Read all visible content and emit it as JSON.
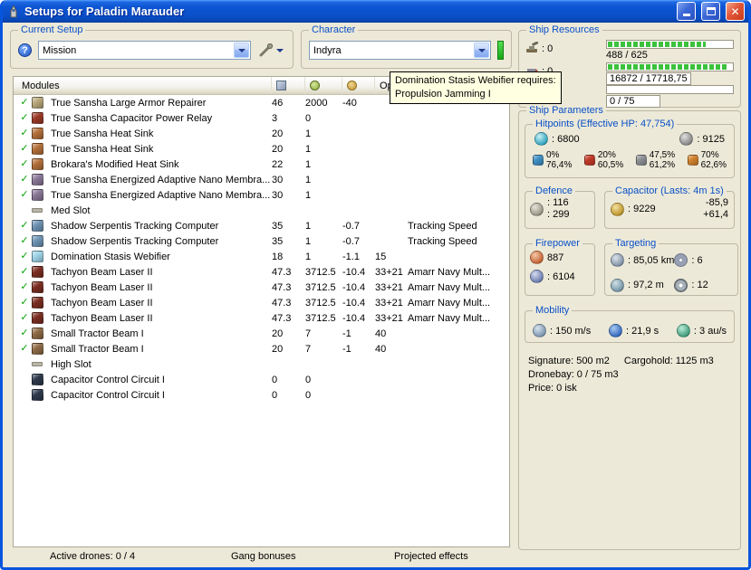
{
  "window": {
    "title": "Setups for Paladin Marauder"
  },
  "current_setup": {
    "label": "Current Setup",
    "value": "Mission"
  },
  "character": {
    "label": "Character",
    "value": "Indyra"
  },
  "ship_resources": {
    "label": "Ship Resources",
    "rows": [
      {
        "icon": "turret-hardpoint-icon",
        "count": ": 0",
        "bar_text": "488 / 625",
        "fill_pct": 78,
        "boxed": false
      },
      {
        "icon": "launcher-hardpoint-icon",
        "count": ": 0",
        "bar_text": "16872 / 17718,75",
        "fill_pct": 95,
        "boxed": true
      },
      {
        "icon": "drone-bay-icon",
        "count": ": 00",
        "bar_text": "0 / 75",
        "fill_pct": 0,
        "boxed": true
      }
    ]
  },
  "tooltip": {
    "line1": "Domination Stasis Webifier requires:",
    "line2": "Propulsion Jamming I"
  },
  "modules_panel": {
    "header_label": "Modules",
    "opti_label": "Opti...",
    "rows": [
      {
        "checked": true,
        "slot": false,
        "icon_color": "#b9a87c",
        "name": "True Sansha Large Armor Repairer",
        "cpu": "46",
        "pg": "2000",
        "cap": "-40",
        "opti": "",
        "charge": ""
      },
      {
        "checked": true,
        "slot": false,
        "icon_color": "#9c3a28",
        "name": "True Sansha Capacitor Power Relay",
        "cpu": "3",
        "pg": "0",
        "cap": "",
        "opti": "",
        "charge": ""
      },
      {
        "checked": true,
        "slot": false,
        "icon_color": "#b4703a",
        "name": "True Sansha Heat Sink",
        "cpu": "20",
        "pg": "1",
        "cap": "",
        "opti": "",
        "charge": ""
      },
      {
        "checked": true,
        "slot": false,
        "icon_color": "#b4703a",
        "name": "True Sansha Heat Sink",
        "cpu": "20",
        "pg": "1",
        "cap": "",
        "opti": "",
        "charge": ""
      },
      {
        "checked": true,
        "slot": false,
        "icon_color": "#b4703a",
        "name": "Brokara's Modified Heat Sink",
        "cpu": "22",
        "pg": "1",
        "cap": "",
        "opti": "",
        "charge": ""
      },
      {
        "checked": true,
        "slot": false,
        "icon_color": "#8a7898",
        "name": "True Sansha Energized Adaptive Nano Membra...",
        "cpu": "30",
        "pg": "1",
        "cap": "",
        "opti": "",
        "charge": ""
      },
      {
        "checked": true,
        "slot": false,
        "icon_color": "#8a7898",
        "name": "True Sansha Energized Adaptive Nano Membra...",
        "cpu": "30",
        "pg": "1",
        "cap": "",
        "opti": "",
        "charge": ""
      },
      {
        "checked": false,
        "slot": true,
        "icon_color": "#b0aca0",
        "name": "Med Slot",
        "cpu": "",
        "pg": "",
        "cap": "",
        "opti": "",
        "charge": ""
      },
      {
        "checked": true,
        "slot": false,
        "icon_color": "#6f94b5",
        "name": "Shadow Serpentis Tracking Computer",
        "cpu": "35",
        "pg": "1",
        "cap": "-0.7",
        "opti": "",
        "charge": "Tracking Speed"
      },
      {
        "checked": true,
        "slot": false,
        "icon_color": "#6f94b5",
        "name": "Shadow Serpentis Tracking Computer",
        "cpu": "35",
        "pg": "1",
        "cap": "-0.7",
        "opti": "",
        "charge": "Tracking Speed"
      },
      {
        "checked": true,
        "slot": false,
        "icon_color": "#9fd4e8",
        "name": "Domination Stasis Webifier",
        "cpu": "18",
        "pg": "1",
        "cap": "-1.1",
        "opti": "15",
        "charge": ""
      },
      {
        "checked": true,
        "slot": false,
        "icon_color": "#7c2e22",
        "name": "Tachyon Beam Laser II",
        "cpu": "47.3",
        "pg": "3712.5",
        "cap": "-10.4",
        "opti": "33+21",
        "charge": "Amarr Navy Mult..."
      },
      {
        "checked": true,
        "slot": false,
        "icon_color": "#7c2e22",
        "name": "Tachyon Beam Laser II",
        "cpu": "47.3",
        "pg": "3712.5",
        "cap": "-10.4",
        "opti": "33+21",
        "charge": "Amarr Navy Mult..."
      },
      {
        "checked": true,
        "slot": false,
        "icon_color": "#7c2e22",
        "name": "Tachyon Beam Laser II",
        "cpu": "47.3",
        "pg": "3712.5",
        "cap": "-10.4",
        "opti": "33+21",
        "charge": "Amarr Navy Mult..."
      },
      {
        "checked": true,
        "slot": false,
        "icon_color": "#7c2e22",
        "name": "Tachyon Beam Laser II",
        "cpu": "47.3",
        "pg": "3712.5",
        "cap": "-10.4",
        "opti": "33+21",
        "charge": "Amarr Navy Mult..."
      },
      {
        "checked": true,
        "slot": false,
        "icon_color": "#8f6b46",
        "name": "Small Tractor Beam I",
        "cpu": "20",
        "pg": "7",
        "cap": "-1",
        "opti": "40",
        "charge": ""
      },
      {
        "checked": true,
        "slot": false,
        "icon_color": "#8f6b46",
        "name": "Small Tractor Beam I",
        "cpu": "20",
        "pg": "7",
        "cap": "-1",
        "opti": "40",
        "charge": ""
      },
      {
        "checked": false,
        "slot": true,
        "icon_color": "#b0aca0",
        "name": "High Slot",
        "cpu": "",
        "pg": "",
        "cap": "",
        "opti": "",
        "charge": ""
      },
      {
        "checked": false,
        "slot": false,
        "icon_color": "#2e3a4c",
        "name": "Capacitor Control Circuit I",
        "cpu": "0",
        "pg": "0",
        "cap": "",
        "opti": "",
        "charge": ""
      },
      {
        "checked": false,
        "slot": false,
        "icon_color": "#2e3a4c",
        "name": "Capacitor Control Circuit I",
        "cpu": "0",
        "pg": "0",
        "cap": "",
        "opti": "",
        "charge": ""
      }
    ]
  },
  "bottom_bar": {
    "active_drones": "Active drones: 0 / 4",
    "gang_bonuses": "Gang bonuses",
    "projected_effects": "Projected effects"
  },
  "ship_parameters": {
    "label": "Ship Parameters",
    "hitpoints": {
      "label": "Hitpoints (Effective HP: 47,754)",
      "shield": ": 6800",
      "armor": ": 9125",
      "resists": [
        {
          "name": "em-resist-icon",
          "color": "#3f8fc4",
          "shield": "0%",
          "armor": "76,4%"
        },
        {
          "name": "thermal-resist-icon",
          "color": "#c23a28",
          "shield": "20%",
          "armor": "60,5%"
        },
        {
          "name": "kinetic-resist-icon",
          "color": "#8d9094",
          "shield": "47,5%",
          "armor": "61,2%"
        },
        {
          "name": "explosive-resist-icon",
          "color": "#d2822e",
          "shield": "70%",
          "armor": "62,6%"
        }
      ]
    },
    "defence": {
      "label": "Defence",
      "shield_recharge": ": 116",
      "armor_repair": ": 299"
    },
    "capacitor": {
      "label": "Capacitor (Lasts: 4m 1s)",
      "capacity": ": 9229",
      "usage": "-85,9",
      "recharge": "+61,4"
    },
    "firepower": {
      "label": "Firepower",
      "dps": "887",
      "volley": ": 6104"
    },
    "targeting": {
      "label": "Targeting",
      "range": ": 85,05 km",
      "max_targets": ": 6",
      "scan_resolution": ": 97,2 m",
      "sensor_strength": ": 12"
    },
    "mobility": {
      "label": "Mobility",
      "max_velocity": ": 150 m/s",
      "align_time": ": 21,9 s",
      "warp_speed": ": 3 au/s"
    },
    "signature": "Signature: 500 m2",
    "cargohold": "Cargohold: 1125 m3",
    "dronebay": "Dronebay: 0 / 75 m3",
    "price": "Price: 0 isk"
  }
}
